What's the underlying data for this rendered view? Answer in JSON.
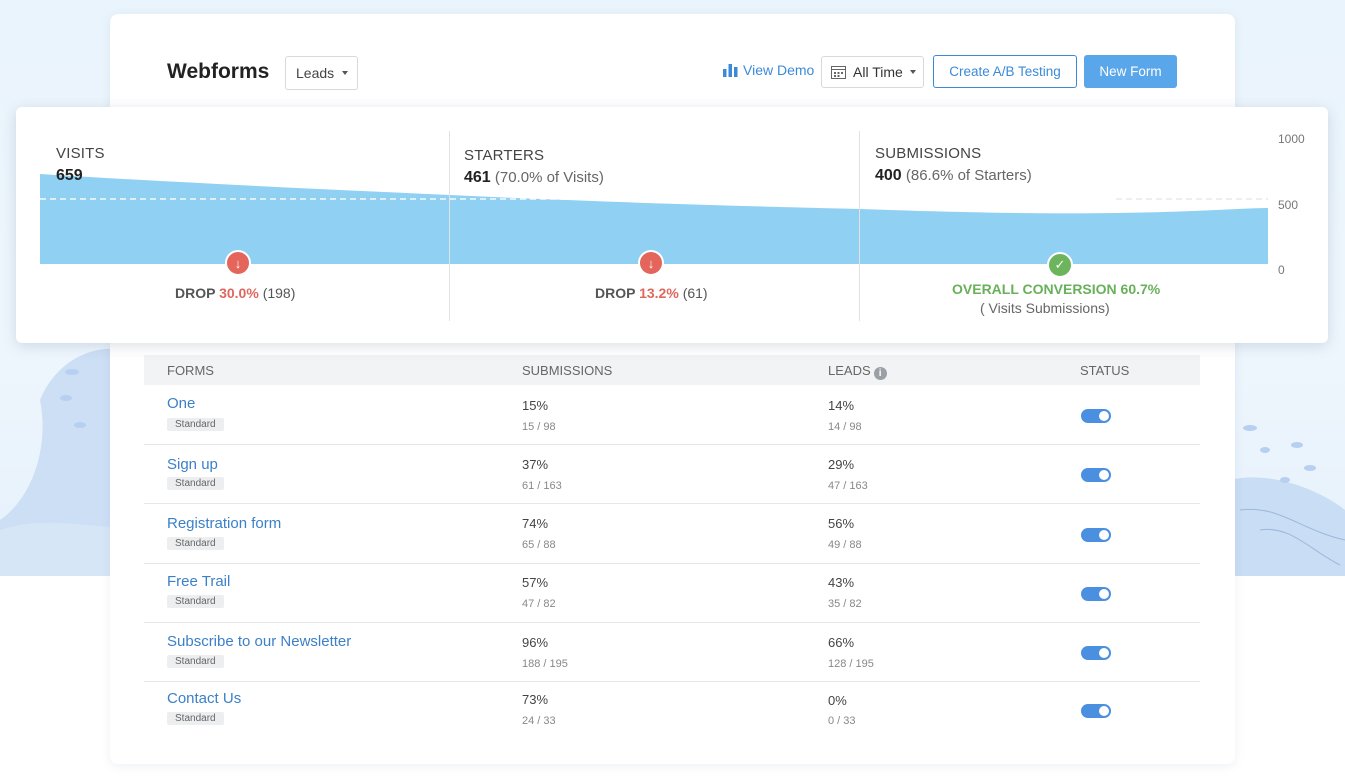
{
  "header": {
    "title": "Webforms",
    "type_dropdown": "Leads",
    "view_demo": "View Demo",
    "time_range": "All Time",
    "ab_button": "Create A/B Testing",
    "new_button": "New Form"
  },
  "funnel": {
    "stages": [
      {
        "label": "VISITS",
        "value": "659",
        "note": ""
      },
      {
        "label": "STARTERS",
        "value": "461",
        "note": "(70.0% of Visits)"
      },
      {
        "label": "SUBMISSIONS",
        "value": "400",
        "note": "(86.6% of Starters)"
      }
    ],
    "drops": [
      {
        "prefix": "DROP",
        "pct": "30.0%",
        "count": "(198)"
      },
      {
        "prefix": "DROP",
        "pct": "13.2%",
        "count": "(61)"
      }
    ],
    "overall": {
      "label": "OVERALL CONVERSION 60.7%",
      "sub": "( Visits Submissions)"
    },
    "axis_ticks": [
      "1000",
      "500",
      "0"
    ],
    "colors": {
      "area": "#8fd0f3",
      "drop": "#e3655b",
      "success": "#6cb55c"
    }
  },
  "table": {
    "headers": {
      "forms": "FORMS",
      "submissions": "SUBMISSIONS",
      "leads": "LEADS",
      "status": "STATUS"
    },
    "rows": [
      {
        "name": "One",
        "tag": "Standard",
        "sub_pct": "15%",
        "sub_ratio": "15 / 98",
        "lead_pct": "14%",
        "lead_ratio": "14 / 98",
        "status": true
      },
      {
        "name": "Sign up",
        "tag": "Standard",
        "sub_pct": "37%",
        "sub_ratio": "61 / 163",
        "lead_pct": "29%",
        "lead_ratio": "47 / 163",
        "status": true
      },
      {
        "name": "Registration form",
        "tag": "Standard",
        "sub_pct": "74%",
        "sub_ratio": "65 / 88",
        "lead_pct": "56%",
        "lead_ratio": "49 / 88",
        "status": true
      },
      {
        "name": "Free Trail",
        "tag": "Standard",
        "sub_pct": "57%",
        "sub_ratio": "47 / 82",
        "lead_pct": "43%",
        "lead_ratio": "35 / 82",
        "status": true
      },
      {
        "name": "Subscribe to our Newsletter",
        "tag": "Standard",
        "sub_pct": "96%",
        "sub_ratio": "188 / 195",
        "lead_pct": "66%",
        "lead_ratio": "128 / 195",
        "status": true
      },
      {
        "name": "Contact Us",
        "tag": "Standard",
        "sub_pct": "73%",
        "sub_ratio": "24 / 33",
        "lead_pct": "0%",
        "lead_ratio": "0 / 33",
        "status": true
      }
    ]
  }
}
